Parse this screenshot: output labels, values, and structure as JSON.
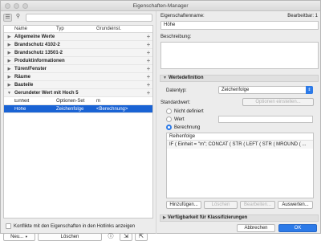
{
  "window": {
    "title": "Eigenschaften-Manager"
  },
  "left": {
    "search_placeholder": "",
    "columns": [
      "Name",
      "Typ",
      "Grundeinst."
    ],
    "groups": [
      "Allgemeine Werte",
      "Brandschutz 4102-2",
      "Brandschutz 13501-2",
      "Produktinformationen",
      "Türen/Fenster",
      "Räume",
      "Bauteile",
      "Gerundeter Wert mit Hoch 5"
    ],
    "items": [
      {
        "name": "Einheit",
        "type": "Optionen-Set",
        "default": "m"
      },
      {
        "name": "Höhe",
        "type": "Zeichenfolge",
        "default": "<Berechnung>"
      }
    ],
    "checkbox_label": "Konflikte mit den Eigenschaften in den Hotlinks anzeigen",
    "new_button": "Neu...",
    "delete_button": "Löschen"
  },
  "right": {
    "name_label": "Eigenschaftenname:",
    "editable": "Bearbeitbar: 1",
    "name_value": "Höhe",
    "description_label": "Beschreibung:",
    "description_value": "",
    "section_values": "Wertedefinition",
    "datatype_label": "Datentyp:",
    "datatype_value": "Zeichenfolge",
    "default_label": "Standardwert:",
    "options_button": "Optionen einstellen...",
    "radio_undefined": "Nicht definiert",
    "radio_value": "Wert",
    "radio_calc": "Berechnung",
    "formula_header": "Reihenfolge",
    "formula_text": "IF ( Einheit = \"m\"; CONCAT ( STR ( LEFT ( STR ( MROUND ( ...",
    "add_button": "Hinzufügen...",
    "remove_button": "Löschen",
    "edit_button": "Bearbeiten...",
    "choose_button": "Auswerten...",
    "section_classification": "Verfügbarkeit für Klassifizierungen",
    "cancel_button": "Abbrechen",
    "ok_button": "OK"
  }
}
